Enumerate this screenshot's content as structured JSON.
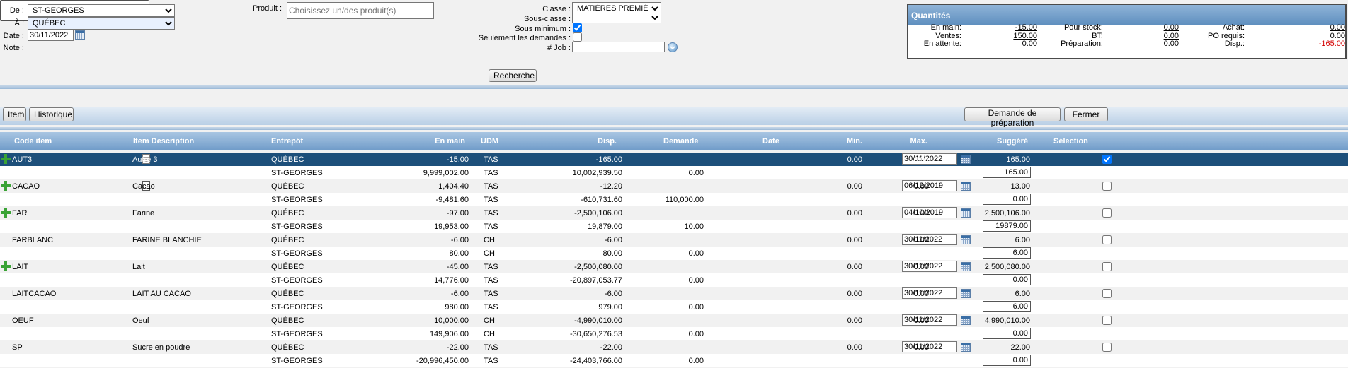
{
  "filters": {
    "de_label": "De :",
    "de_value": "ST-GEORGES",
    "a_label": "À :",
    "a_value": "QUÉBEC",
    "date_label": "Date :",
    "date_value": "30/11/2022",
    "note_label": "Note :",
    "note_value": "",
    "produit_label": "Produit :",
    "produit_placeholder": "Choisissez un/des produit(s)",
    "classe_label": "Classe :",
    "classe_value": "MATIÈRES PREMIÈRES",
    "sousclasse_label": "Sous-classe :",
    "sousclasse_value": "",
    "sousmin_label": "Sous minimum :",
    "sousmin_checked": true,
    "demandes_label": "Seulement les demandes :",
    "demandes_checked": false,
    "job_label": "# Job :",
    "job_value": "",
    "search_button": "Recherche"
  },
  "quantities": {
    "title": "Quantités",
    "rows": [
      [
        {
          "label": "En main:",
          "value": "-15.00",
          "link": true
        },
        {
          "label": "Pour stock:",
          "value": "0.00",
          "link": true
        },
        {
          "label": "Achat:",
          "value": "0.00",
          "link": true
        }
      ],
      [
        {
          "label": "Ventes:",
          "value": "150.00",
          "link": true
        },
        {
          "label": "BT:",
          "value": "0.00",
          "link": true
        },
        {
          "label": "PO requis:",
          "value": "0.00",
          "link": false
        }
      ],
      [
        {
          "label": "En attente:",
          "value": "0.00",
          "link": false
        },
        {
          "label": "Préparation:",
          "value": "0.00",
          "link": false
        },
        {
          "label": "Disp.:",
          "value": "-165.00",
          "link": false,
          "negative": true
        }
      ]
    ]
  },
  "toolbar": {
    "item_button": "Item",
    "historique_button": "Historique",
    "demande_button": "Demande de préparation",
    "fermer_button": "Fermer"
  },
  "table": {
    "headers": {
      "code": "Code item",
      "desc": "Item Description",
      "entrepot": "Entrepôt",
      "enmain": "En main",
      "udm": "UDM",
      "disp": "Disp.",
      "demande": "Demande",
      "date": "Date",
      "min": "Min.",
      "max": "Max.",
      "suggere": "Suggéré",
      "selection": "Sélection"
    },
    "rows": [
      {
        "code": "AUT3",
        "desc": "Autre 3",
        "plus": true,
        "doc": "page",
        "selected": true,
        "date": "30/11/2022",
        "min": "0.00",
        "max": "0.00",
        "suggere": "165.00",
        "sug_input": "165.00",
        "w1": {
          "entrepot": "QUÉBEC",
          "enmain": "-15.00",
          "udm": "TAS",
          "disp": "-165.00",
          "demande": ""
        },
        "w2": {
          "entrepot": "ST-GEORGES",
          "enmain": "9,999,002.00",
          "udm": "TAS",
          "disp": "10,002,939.50",
          "demande": "0.00"
        }
      },
      {
        "code": "CACAO",
        "desc": "Cacao",
        "plus": true,
        "doc": "mag",
        "selected": false,
        "date": "06/12/2019",
        "min": "0.00",
        "max": "0.00",
        "suggere": "13.00",
        "sug_input": "0.00",
        "w1": {
          "entrepot": "QUÉBEC",
          "enmain": "1,404.40",
          "udm": "TAS",
          "disp": "-12.20",
          "demande": ""
        },
        "w2": {
          "entrepot": "ST-GEORGES",
          "enmain": "-9,481.60",
          "udm": "TAS",
          "disp": "-610,731.60",
          "demande": "110,000.00"
        }
      },
      {
        "code": "FAR",
        "desc": "Farine",
        "plus": true,
        "doc": "",
        "selected": false,
        "date": "04/10/2019",
        "min": "0.00",
        "max": "0.00",
        "suggere": "2,500,106.00",
        "sug_input": "19879.00",
        "w1": {
          "entrepot": "QUÉBEC",
          "enmain": "-97.00",
          "udm": "TAS",
          "disp": "-2,500,106.00",
          "demande": ""
        },
        "w2": {
          "entrepot": "ST-GEORGES",
          "enmain": "19,953.00",
          "udm": "TAS",
          "disp": "19,879.00",
          "demande": "10.00"
        }
      },
      {
        "code": "FARBLANC",
        "desc": "FARINE BLANCHIE",
        "plus": false,
        "doc": "",
        "selected": false,
        "date": "30/11/2022",
        "min": "0.00",
        "max": "0.00",
        "suggere": "6.00",
        "sug_input": "6.00",
        "w1": {
          "entrepot": "QUÉBEC",
          "enmain": "-6.00",
          "udm": "CH",
          "disp": "-6.00",
          "demande": ""
        },
        "w2": {
          "entrepot": "ST-GEORGES",
          "enmain": "80.00",
          "udm": "CH",
          "disp": "80.00",
          "demande": "0.00"
        }
      },
      {
        "code": "LAIT",
        "desc": "Lait",
        "plus": true,
        "doc": "",
        "selected": false,
        "date": "30/11/2022",
        "min": "0.00",
        "max": "0.00",
        "suggere": "2,500,080.00",
        "sug_input": "0.00",
        "w1": {
          "entrepot": "QUÉBEC",
          "enmain": "-45.00",
          "udm": "TAS",
          "disp": "-2,500,080.00",
          "demande": ""
        },
        "w2": {
          "entrepot": "ST-GEORGES",
          "enmain": "14,776.00",
          "udm": "TAS",
          "disp": "-20,897,053.77",
          "demande": "0.00"
        }
      },
      {
        "code": "LAITCACAO",
        "desc": "LAIT AU CACAO",
        "plus": false,
        "doc": "",
        "selected": false,
        "date": "30/11/2022",
        "min": "0.00",
        "max": "0.00",
        "suggere": "6.00",
        "sug_input": "6.00",
        "w1": {
          "entrepot": "QUÉBEC",
          "enmain": "-6.00",
          "udm": "TAS",
          "disp": "-6.00",
          "demande": ""
        },
        "w2": {
          "entrepot": "ST-GEORGES",
          "enmain": "980.00",
          "udm": "TAS",
          "disp": "979.00",
          "demande": "0.00"
        }
      },
      {
        "code": "OEUF",
        "desc": "Oeuf",
        "plus": false,
        "doc": "",
        "selected": false,
        "date": "30/11/2022",
        "min": "0.00",
        "max": "0.00",
        "suggere": "4,990,010.00",
        "sug_input": "0.00",
        "w1": {
          "entrepot": "QUÉBEC",
          "enmain": "10,000.00",
          "udm": "CH",
          "disp": "-4,990,010.00",
          "demande": ""
        },
        "w2": {
          "entrepot": "ST-GEORGES",
          "enmain": "149,906.00",
          "udm": "CH",
          "disp": "-30,650,276.53",
          "demande": "0.00"
        }
      },
      {
        "code": "SP",
        "desc": "Sucre en poudre",
        "plus": false,
        "doc": "",
        "selected": false,
        "date": "30/11/2022",
        "min": "0.00",
        "max": "0.00",
        "suggere": "22.00",
        "sug_input": "0.00",
        "w1": {
          "entrepot": "QUÉBEC",
          "enmain": "-22.00",
          "udm": "TAS",
          "disp": "-22.00",
          "demande": ""
        },
        "w2": {
          "entrepot": "ST-GEORGES",
          "enmain": "-20,996,450.00",
          "udm": "TAS",
          "disp": "-24,403,766.00",
          "demande": "0.00"
        }
      }
    ]
  }
}
